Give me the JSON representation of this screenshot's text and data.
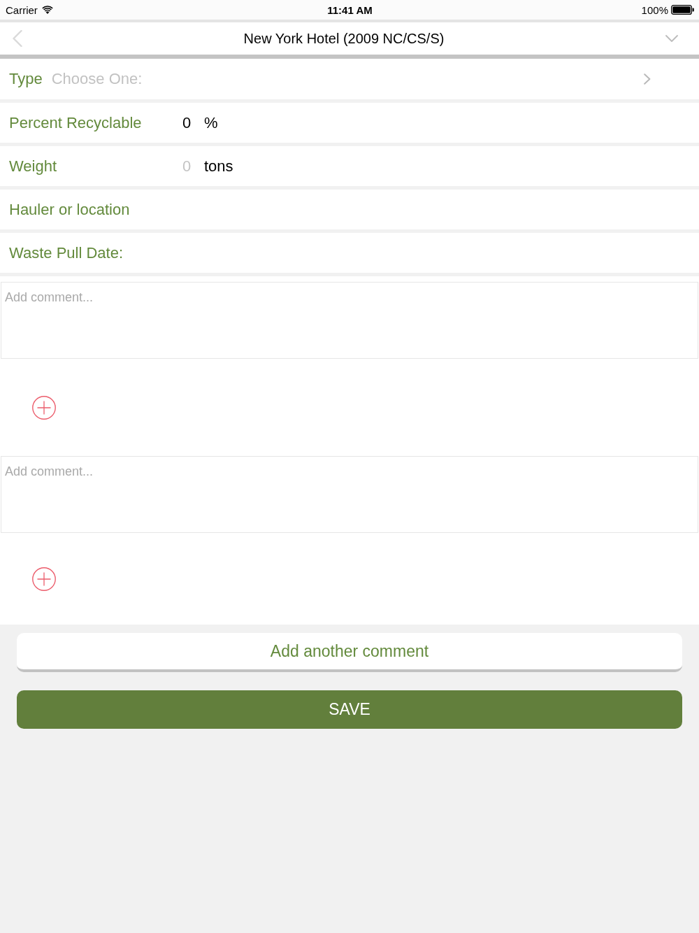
{
  "status_bar": {
    "carrier": "Carrier",
    "time": "11:41 AM",
    "battery": "100%"
  },
  "nav_bar": {
    "title": "New York Hotel (2009 NC/CS/S)"
  },
  "fields": [
    {
      "kind": "picker",
      "label": "Type",
      "placeholder": "Choose One:"
    },
    {
      "kind": "number",
      "label": "Percent Recyclable",
      "value": "0",
      "unit": "%"
    },
    {
      "kind": "number",
      "label": "Weight",
      "placeholder": "0",
      "unit": "tons"
    },
    {
      "kind": "entry",
      "label": "Hauler or location"
    },
    {
      "kind": "entry",
      "label": "Waste Pull Date:"
    }
  ],
  "comments": [
    {
      "placeholder": "Add comment..."
    },
    {
      "placeholder": "Add comment..."
    }
  ],
  "buttons": [
    {
      "kind": "secondary",
      "label": "Add another comment"
    },
    {
      "kind": "primary",
      "label": "SAVE"
    }
  ]
}
